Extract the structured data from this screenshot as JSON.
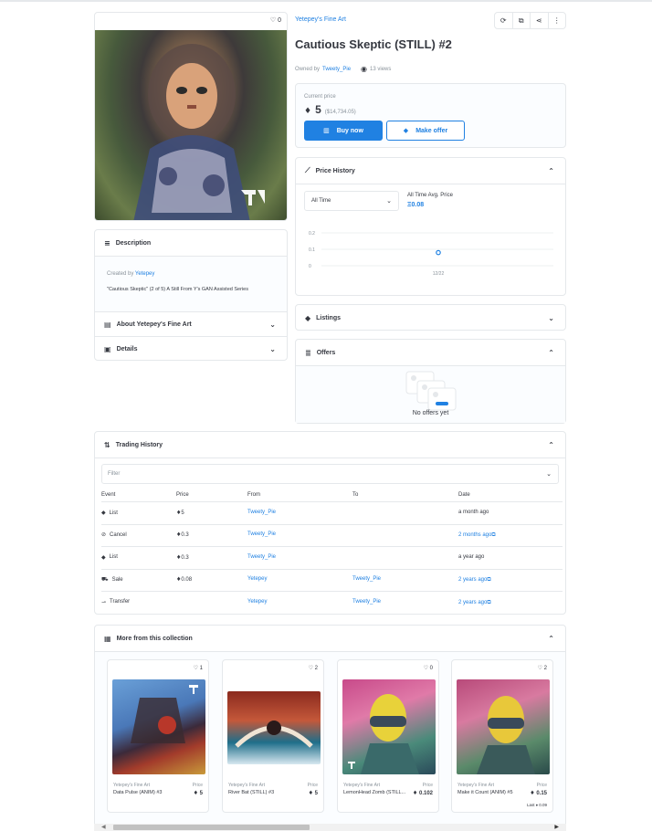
{
  "collection_name": "Yetepey's Fine Art",
  "item_title": "Cautious Skeptic (STILL) #2",
  "favorites_count": "0",
  "owner": {
    "prefix": "Owned by",
    "name": "Tweety_Pie"
  },
  "views": "13 views",
  "price_box": {
    "label": "Current price",
    "eth": "5",
    "usd": "($14,734.05)",
    "buy_label": "Buy now",
    "offer_label": "Make offer"
  },
  "price_history": {
    "title": "Price History",
    "range_select": "All Time",
    "avg_label": "All Time Avg. Price",
    "avg_value": "Ξ0.08"
  },
  "chart_data": {
    "type": "scatter",
    "x": [
      "12/22"
    ],
    "values": [
      0.08
    ],
    "yticks": [
      "0.2",
      "0.1",
      "0"
    ],
    "ylim": [
      0,
      0.2
    ],
    "grid": true
  },
  "listings": {
    "title": "Listings"
  },
  "offers": {
    "title": "Offers",
    "empty_text": "No offers yet"
  },
  "description": {
    "title": "Description",
    "created_prefix": "Created by",
    "creator": "Yetepey",
    "body": "\"Cautious Skeptic\" (2 of 5) A Still From Y's GAN Assisted Series"
  },
  "about": {
    "title": "About Yetepey's Fine Art"
  },
  "details": {
    "title": "Details"
  },
  "trading_history": {
    "title": "Trading History",
    "filter_placeholder": "Filter",
    "headers": [
      "Event",
      "Price",
      "From",
      "To",
      "Date"
    ],
    "rows": [
      {
        "icon": "tag-icon",
        "event": "List",
        "price": "5",
        "from": "Tweety_Pie",
        "to": "",
        "date": "a month ago",
        "date_link": false
      },
      {
        "icon": "cancel-icon",
        "event": "Cancel",
        "price": "0.3",
        "from": "Tweety_Pie",
        "to": "",
        "date": "2 months ago",
        "date_link": true
      },
      {
        "icon": "tag-icon",
        "event": "List",
        "price": "0.3",
        "from": "Tweety_Pie",
        "to": "",
        "date": "a year ago",
        "date_link": false
      },
      {
        "icon": "cart-icon",
        "event": "Sale",
        "price": "0.08",
        "from": "Yetepey",
        "to": "Tweety_Pie",
        "date": "2 years ago",
        "date_link": true
      },
      {
        "icon": "transfer-icon",
        "event": "Transfer",
        "price": "",
        "from": "Yetepey",
        "to": "Tweety_Pie",
        "date": "2 years ago",
        "date_link": true
      }
    ]
  },
  "more_collection": {
    "title": "More from this collection",
    "cards": [
      {
        "fav": "1",
        "collection": "Yetepey's Fine Art",
        "name": "Data Pulse (ANIM) #3",
        "price_label": "Price",
        "price": "5",
        "extra": ""
      },
      {
        "fav": "2",
        "collection": "Yetepey's Fine Art",
        "name": "River Bat (STILL) #3",
        "price_label": "Price",
        "price": "5",
        "extra": ""
      },
      {
        "fav": "0",
        "collection": "Yetepey's Fine Art",
        "name": "LemonHead Zomb (STILL...",
        "price_label": "Price",
        "price": "0.102",
        "extra": ""
      },
      {
        "fav": "2",
        "collection": "Yetepey's Fine Art",
        "name": "Make it Count (ANIM) #5",
        "price_label": "Price",
        "price": "0.15",
        "extra": "Last ♦ 0.09"
      }
    ]
  },
  "colors": {
    "accent": "#2081e2",
    "border": "#e5e8eb",
    "text": "#353840",
    "muted": "#8a939b"
  }
}
